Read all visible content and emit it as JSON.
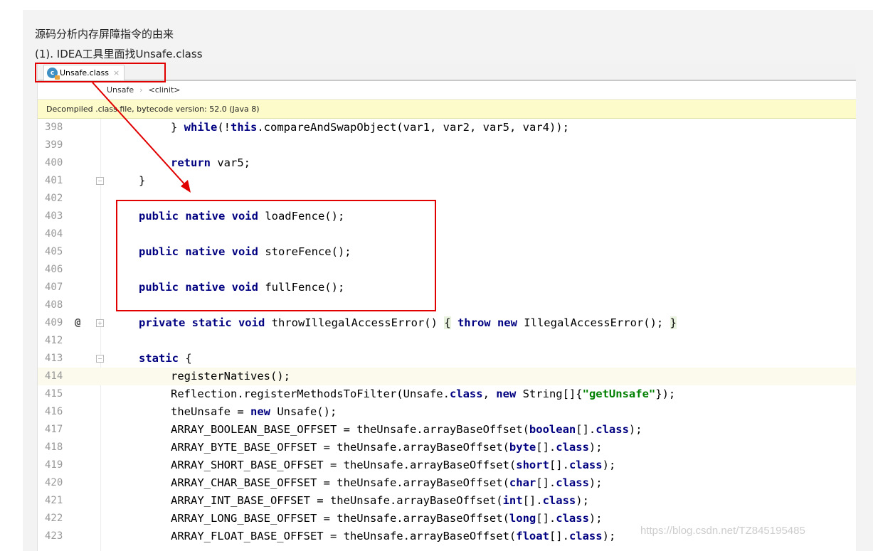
{
  "heading": "源码分析内存屏障指令的由来",
  "subheading": "(1). IDEA工具里面找Unsafe.class",
  "tab": {
    "label": "Unsafe.class",
    "close": "×",
    "icon": "class-icon",
    "icon_letter": "c"
  },
  "breadcrumb": {
    "class_name": "Unsafe",
    "separator": "›",
    "method": "<clinit>"
  },
  "banner": "Decompiled .class file, bytecode version: 52.0 (Java 8)",
  "gutter_marker": "@",
  "lines": [
    {
      "no": "398",
      "indent": 2,
      "tokens": [
        [
          "t",
          "} "
        ],
        [
          "k",
          "while"
        ],
        [
          "t",
          "(!"
        ],
        [
          "k",
          "this"
        ],
        [
          "t",
          ".compareAndSwapObject(var1, var2, var5, var4));"
        ]
      ]
    },
    {
      "no": "399",
      "indent": 0,
      "tokens": []
    },
    {
      "no": "400",
      "indent": 2,
      "tokens": [
        [
          "k",
          "return"
        ],
        [
          "t",
          " var5;"
        ]
      ]
    },
    {
      "no": "401",
      "indent": 1,
      "tokens": [
        [
          "t",
          "}"
        ]
      ],
      "fold": true
    },
    {
      "no": "402",
      "indent": 0,
      "tokens": []
    },
    {
      "no": "403",
      "indent": 1,
      "tokens": [
        [
          "k",
          "public native void"
        ],
        [
          "t",
          " loadFence();"
        ]
      ]
    },
    {
      "no": "404",
      "indent": 0,
      "tokens": []
    },
    {
      "no": "405",
      "indent": 1,
      "tokens": [
        [
          "k",
          "public native void"
        ],
        [
          "t",
          " storeFence();"
        ]
      ]
    },
    {
      "no": "406",
      "indent": 0,
      "tokens": []
    },
    {
      "no": "407",
      "indent": 1,
      "tokens": [
        [
          "k",
          "public native void"
        ],
        [
          "t",
          " fullFence();"
        ]
      ]
    },
    {
      "no": "408",
      "indent": 0,
      "tokens": []
    },
    {
      "no": "409",
      "indent": 1,
      "at": true,
      "fold": true,
      "tokens": [
        [
          "k",
          "private static void"
        ],
        [
          "t",
          " throwIllegalAccessError() "
        ],
        [
          "b",
          "{"
        ],
        [
          "t",
          " "
        ],
        [
          "k",
          "throw new"
        ],
        [
          "t",
          " IllegalAccessError(); "
        ],
        [
          "b",
          "}"
        ]
      ]
    },
    {
      "no": "412",
      "indent": 0,
      "tokens": []
    },
    {
      "no": "413",
      "indent": 1,
      "fold": true,
      "tokens": [
        [
          "k",
          "static"
        ],
        [
          "t",
          " {"
        ]
      ]
    },
    {
      "no": "414",
      "indent": 2,
      "highlight": true,
      "tokens": [
        [
          "t",
          "registerNatives();"
        ]
      ]
    },
    {
      "no": "415",
      "indent": 2,
      "tokens": [
        [
          "t",
          "Reflection.registerMethodsToFilter(Unsafe."
        ],
        [
          "k",
          "class"
        ],
        [
          "t",
          ", "
        ],
        [
          "k",
          "new"
        ],
        [
          "t",
          " String[]{"
        ],
        [
          "s",
          "\"getUnsafe\""
        ],
        [
          "t",
          "});"
        ]
      ]
    },
    {
      "no": "416",
      "indent": 2,
      "tokens": [
        [
          "t",
          "theUnsafe = "
        ],
        [
          "k",
          "new"
        ],
        [
          "t",
          " Unsafe();"
        ]
      ]
    },
    {
      "no": "417",
      "indent": 2,
      "tokens": [
        [
          "t",
          "ARRAY_BOOLEAN_BASE_OFFSET = theUnsafe.arrayBaseOffset("
        ],
        [
          "k",
          "boolean"
        ],
        [
          "t",
          "[]."
        ],
        [
          "k",
          "class"
        ],
        [
          "t",
          ");"
        ]
      ]
    },
    {
      "no": "418",
      "indent": 2,
      "tokens": [
        [
          "t",
          "ARRAY_BYTE_BASE_OFFSET = theUnsafe.arrayBaseOffset("
        ],
        [
          "k",
          "byte"
        ],
        [
          "t",
          "[]."
        ],
        [
          "k",
          "class"
        ],
        [
          "t",
          ");"
        ]
      ]
    },
    {
      "no": "419",
      "indent": 2,
      "tokens": [
        [
          "t",
          "ARRAY_SHORT_BASE_OFFSET = theUnsafe.arrayBaseOffset("
        ],
        [
          "k",
          "short"
        ],
        [
          "t",
          "[]."
        ],
        [
          "k",
          "class"
        ],
        [
          "t",
          ");"
        ]
      ]
    },
    {
      "no": "420",
      "indent": 2,
      "tokens": [
        [
          "t",
          "ARRAY_CHAR_BASE_OFFSET = theUnsafe.arrayBaseOffset("
        ],
        [
          "k",
          "char"
        ],
        [
          "t",
          "[]."
        ],
        [
          "k",
          "class"
        ],
        [
          "t",
          ");"
        ]
      ]
    },
    {
      "no": "421",
      "indent": 2,
      "tokens": [
        [
          "t",
          "ARRAY_INT_BASE_OFFSET = theUnsafe.arrayBaseOffset("
        ],
        [
          "k",
          "int"
        ],
        [
          "t",
          "[]."
        ],
        [
          "k",
          "class"
        ],
        [
          "t",
          ");"
        ]
      ]
    },
    {
      "no": "422",
      "indent": 2,
      "tokens": [
        [
          "t",
          "ARRAY_LONG_BASE_OFFSET = theUnsafe.arrayBaseOffset("
        ],
        [
          "k",
          "long"
        ],
        [
          "t",
          "[]."
        ],
        [
          "k",
          "class"
        ],
        [
          "t",
          ");"
        ]
      ]
    },
    {
      "no": "423",
      "indent": 2,
      "tokens": [
        [
          "t",
          "ARRAY_FLOAT_BASE_OFFSET = theUnsafe.arrayBaseOffset("
        ],
        [
          "k",
          "float"
        ],
        [
          "t",
          "[]."
        ],
        [
          "k",
          "class"
        ],
        [
          "t",
          ");"
        ]
      ]
    }
  ],
  "watermark": "https://blog.csdn.net/TZ845195485",
  "colors": {
    "keyword": "#000080",
    "string": "#008000",
    "annotation": "#e00000",
    "banner": "#fdfbc9",
    "highlight_line": "#fcfaed"
  }
}
